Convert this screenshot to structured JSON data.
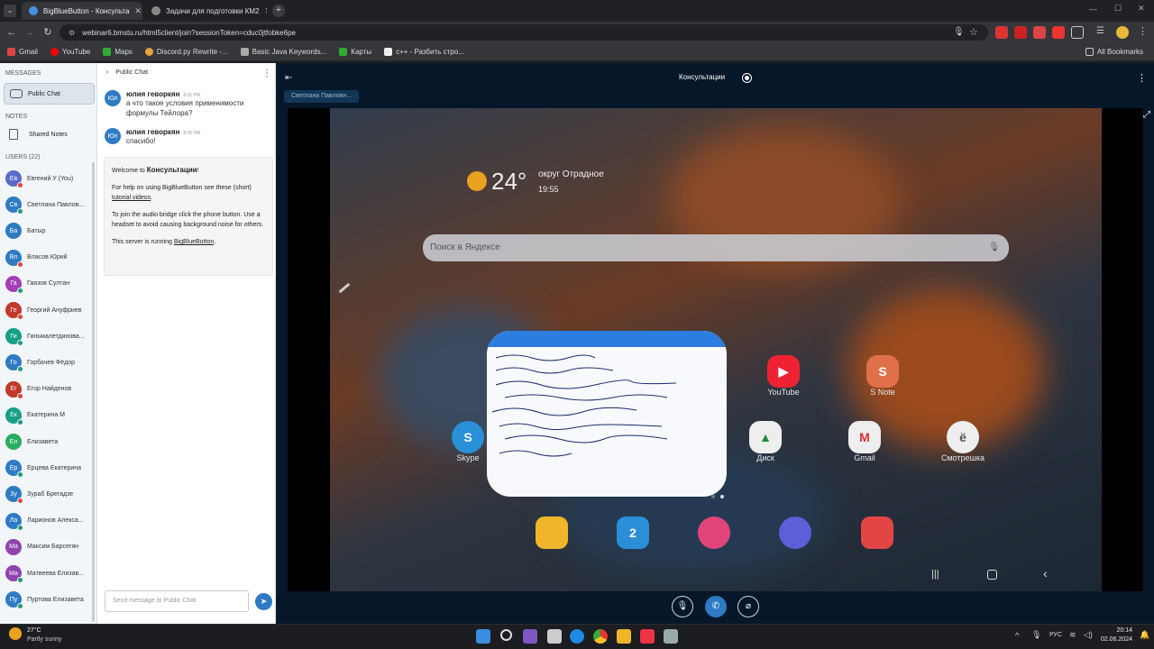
{
  "browser": {
    "tabs": [
      {
        "label": "BigBlueButton - Консульта",
        "active": true
      },
      {
        "label": "Задачи для подготовки КМ2",
        "active": false
      }
    ],
    "url": "webinar6.bmstu.ru/html5client/join?sessionToken=cduc0jtfobke6pe",
    "bookmarks": [
      "Gmail",
      "YouTube",
      "Maps",
      "Discord.py Rewrite -...",
      "Basic Java Keywords...",
      "Карты",
      "c++ - Разбить стро..."
    ],
    "all_bookmarks": "All Bookmarks"
  },
  "nav": {
    "messages_header": "MESSAGES",
    "public_chat": "Public Chat",
    "notes_header": "NOTES",
    "shared_notes": "Shared Notes",
    "users_header": "USERS (22)",
    "users": [
      {
        "initials": "Ев",
        "name": "Евгений У (You)",
        "color": "#5b6ac9",
        "dot": "#e0453a"
      },
      {
        "initials": "Св",
        "name": "Светлана Павлов...",
        "color": "#2e7bc4",
        "dot": "#1e9e73"
      },
      {
        "initials": "Ба",
        "name": "Батыр",
        "color": "#2e7bc4",
        "dot": ""
      },
      {
        "initials": "Вл",
        "name": "Власов Юрий",
        "color": "#2e7bc4",
        "dot": "#e0453a"
      },
      {
        "initials": "Га",
        "name": "Гаязов Султан",
        "color": "#a23fb5",
        "dot": "#1e9e73"
      },
      {
        "initials": "Ге",
        "name": "Георгий Ануфриев",
        "color": "#c0392b",
        "dot": "#e0453a"
      },
      {
        "initials": "Ги",
        "name": "Гильмалетдинова...",
        "color": "#16a085",
        "dot": "#1e9e73"
      },
      {
        "initials": "Го",
        "name": "Горбачев Фёдор",
        "color": "#2e7bc4",
        "dot": "#1e9e73"
      },
      {
        "initials": "Ег",
        "name": "Егор Найденов",
        "color": "#c0392b",
        "dot": "#e0453a"
      },
      {
        "initials": "Ек",
        "name": "Екатерина М",
        "color": "#16a085",
        "dot": "#1e9e73"
      },
      {
        "initials": "Ел",
        "name": "Елизавета",
        "color": "#27ae60",
        "dot": ""
      },
      {
        "initials": "Ер",
        "name": "Ерцева Екатерина",
        "color": "#2e7bc4",
        "dot": "#1e9e73"
      },
      {
        "initials": "Зу",
        "name": "Зураб Брегадзе",
        "color": "#2e7bc4",
        "dot": "#e0453a"
      },
      {
        "initials": "Ла",
        "name": "Ларионов Алекса...",
        "color": "#2e7bc4",
        "dot": "#1e9e73"
      },
      {
        "initials": "Ма",
        "name": "Максим Барсегян",
        "color": "#8e44ad",
        "dot": ""
      },
      {
        "initials": "Ма",
        "name": "Матвеева Елизав...",
        "color": "#8e44ad",
        "dot": "#1e9e73"
      },
      {
        "initials": "Пу",
        "name": "Пуртова Елизавета",
        "color": "#2e7bc4",
        "dot": "#1e9e73"
      }
    ]
  },
  "chat": {
    "header": "Public Chat",
    "messages": [
      {
        "initials": "Юл",
        "author": "юлия геворкян",
        "time": "8:01 PM",
        "text": "а что такое условия применимости формулы Тейлора?"
      },
      {
        "initials": "Юл",
        "author": "юлия геворкян",
        "time": "8:05 PM",
        "text": "спасибо!"
      }
    ],
    "welcome": {
      "line1_pre": "Welcome to ",
      "line1_bold": "Консультации",
      "line1_post": "!",
      "line2_pre": "For help on using BigBlueButton see these (short) ",
      "line2_link": "tutorial videos",
      "line2_post": ".",
      "line3": "To join the audio bridge click the phone button. Use a headset to avoid causing background noise for others.",
      "line4_pre": "This server is running ",
      "line4_link": "BigBlueButton",
      "line4_post": "."
    },
    "input_placeholder": "Send message to Public Chat"
  },
  "stage": {
    "session_title": "Консультации",
    "presenter": "Светлана Павловн...",
    "shared_screen": {
      "temperature": "24°",
      "location": "округ Отрадное",
      "time": "19:55",
      "search_placeholder": "Поиск в Яндексе",
      "apps": [
        "YouTube",
        "S Note",
        "Skype",
        "Диск",
        "Gmail",
        "Смотрешка"
      ],
      "calendar_day": "2"
    }
  },
  "taskbar": {
    "weather_temp": "27°C",
    "weather_desc": "Partly sunny",
    "lang": "РУС",
    "clock_time": "20:14",
    "clock_date": "02.06.2024"
  },
  "colors": {
    "accent": "#2e7bc4",
    "stage_bg": "#06172a"
  }
}
